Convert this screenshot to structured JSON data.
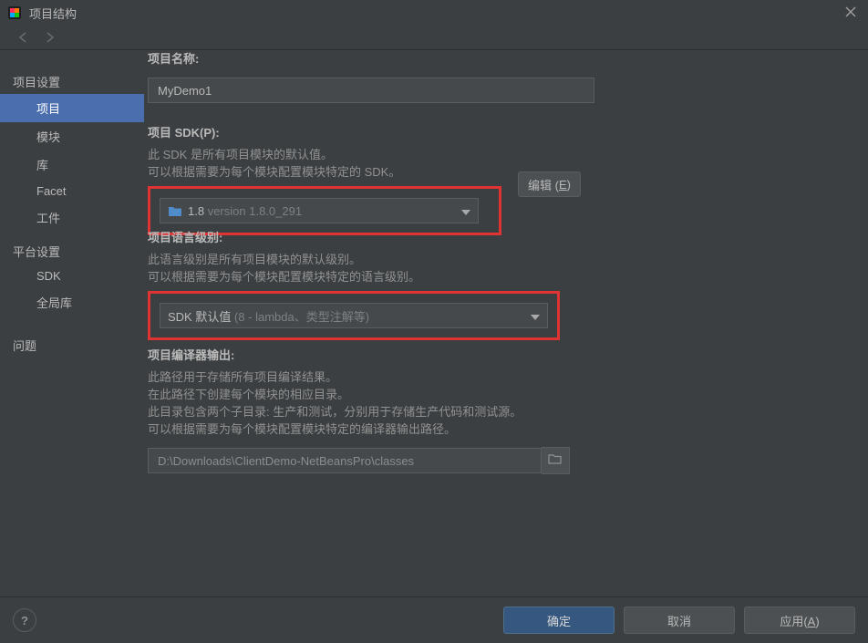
{
  "window": {
    "title": "项目结构"
  },
  "sidebar": {
    "section1_title": "项目设置",
    "items1": [
      "项目",
      "模块",
      "库",
      "Facet",
      "工件"
    ],
    "section2_title": "平台设置",
    "items2": [
      "SDK",
      "全局库"
    ],
    "section3_item": "问题"
  },
  "main": {
    "name_label": "项目名称:",
    "name_value": "MyDemo1",
    "sdk_label": "项目 SDK(P):",
    "sdk_desc1": "此 SDK 是所有项目模块的默认值。",
    "sdk_desc2": "可以根据需要为每个模块配置模块特定的 SDK。",
    "sdk_sel_prefix": "1.8",
    "sdk_sel_suffix": "version 1.8.0_291",
    "edit_btn_text": "编辑 (",
    "edit_btn_mnemonic": "E",
    "edit_btn_close": ")",
    "lang_label": "项目语言级别:",
    "lang_desc1": "此语言级别是所有项目模块的默认级别。",
    "lang_desc2": "可以根据需要为每个模块配置模块特定的语言级别。",
    "lang_sel_prefix": "SDK 默认值",
    "lang_sel_suffix": "(8 - lambda、类型注解等)",
    "out_label": "项目编译器输出:",
    "out_desc1": "此路径用于存储所有项目编译结果。",
    "out_desc2": "在此路径下创建每个模块的相应目录。",
    "out_desc3": "此目录包含两个子目录: 生产和测试，分别用于存储生产代码和测试源。",
    "out_desc4": "可以根据需要为每个模块配置模块特定的编译器输出路径。",
    "out_path": "D:\\Downloads\\ClientDemo-NetBeansPro\\classes"
  },
  "buttons": {
    "ok": "确定",
    "cancel": "取消",
    "apply_text": "应用(",
    "apply_mnemonic": "A",
    "apply_close": ")"
  }
}
